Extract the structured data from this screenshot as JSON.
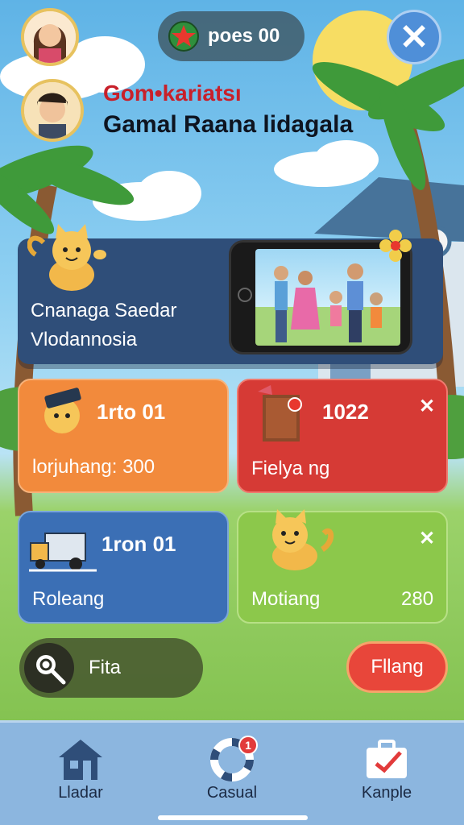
{
  "header": {
    "coins_label": "poes 00",
    "close_label": "✕",
    "title_line1": "Gom•kariatsı",
    "title_line2": "Gamal Raana lidagala"
  },
  "banner": {
    "line1": "Cnanaga Saedar",
    "line2": "Vlodannosia"
  },
  "cards": [
    {
      "title": "1rto 01",
      "subtitle": "lorjuhang: 300",
      "color": "#f28a3c"
    },
    {
      "title": "1022",
      "subtitle": "Fielya ng",
      "close": "✕",
      "color": "#d63a35"
    },
    {
      "title": "1ron 01",
      "subtitle": "Roleang",
      "color": "#3b6fb5"
    },
    {
      "title": "",
      "subtitle": "Motiang",
      "value": "280",
      "close": "✕",
      "color": "#8cc84b"
    }
  ],
  "search": {
    "label": "Fita"
  },
  "play_button": {
    "label": "Fllang"
  },
  "bottom_nav": [
    {
      "label": "Lladar",
      "icon": "house-icon"
    },
    {
      "label": "Casual",
      "icon": "lifebuoy-icon",
      "badge": "1"
    },
    {
      "label": "Kanple",
      "icon": "briefcase-icon"
    }
  ]
}
